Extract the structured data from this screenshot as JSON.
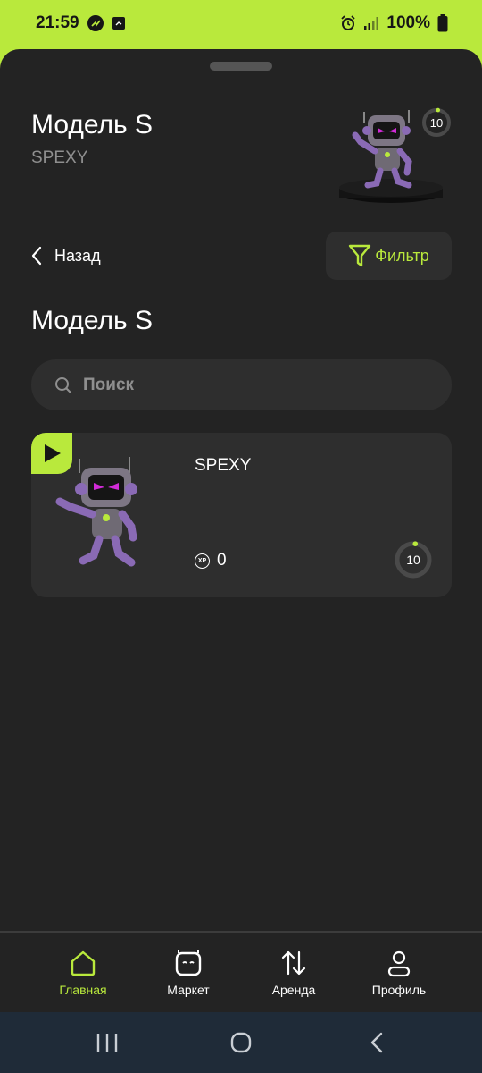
{
  "status_bar": {
    "time": "21:59",
    "battery": "100%",
    "icons": [
      "cast-icon",
      "app-notification-icon",
      "alarm-icon",
      "signal-icon",
      "battery-icon"
    ]
  },
  "header": {
    "title": "Модель S",
    "subtitle": "SPEXY",
    "level": "10",
    "level_progress": 0.02
  },
  "actions": {
    "back_label": "Назад",
    "filter_label": "Фильтр"
  },
  "section": {
    "title": "Модель S"
  },
  "search": {
    "placeholder": "Поиск",
    "value": ""
  },
  "cards": [
    {
      "name": "SPEXY",
      "xp": "0",
      "xp_badge": "XP",
      "level": "10",
      "level_progress": 0.02
    }
  ],
  "nav": {
    "items": [
      {
        "label": "Главная",
        "icon": "home-icon",
        "active": true
      },
      {
        "label": "Маркет",
        "icon": "market-robot-icon",
        "active": false
      },
      {
        "label": "Аренда",
        "icon": "swap-arrows-icon",
        "active": false
      },
      {
        "label": "Профиль",
        "icon": "profile-icon",
        "active": false
      }
    ]
  },
  "colors": {
    "accent": "#b9e93c",
    "background": "#232323",
    "surface": "#2e2e2e",
    "muted_text": "#8f8f8f",
    "system_nav": "#1f2b38"
  }
}
